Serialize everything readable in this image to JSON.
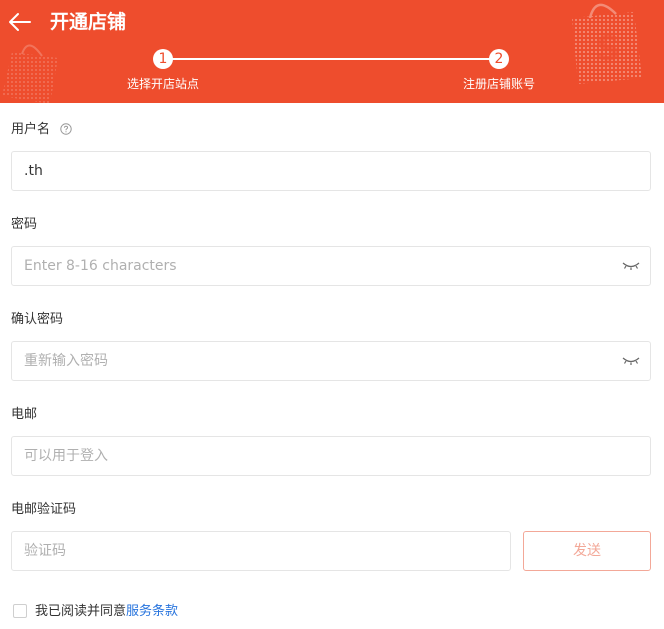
{
  "header": {
    "title": "开通店铺",
    "back_icon": "arrow-left-icon",
    "background_color": "#ee4d2d"
  },
  "steps": [
    {
      "number": "1",
      "label": "选择开店站点"
    },
    {
      "number": "2",
      "label": "注册店铺账号"
    }
  ],
  "form": {
    "username": {
      "label": "用户名",
      "value": ".th",
      "help_icon": "question-circle-icon"
    },
    "password": {
      "label": "密码",
      "placeholder": "Enter 8-16 characters",
      "icon": "eye-closed-icon"
    },
    "confirm_password": {
      "label": "确认密码",
      "placeholder": "重新输入密码",
      "icon": "eye-closed-icon"
    },
    "email": {
      "label": "电邮",
      "placeholder": "可以用于登入"
    },
    "email_code": {
      "label": "电邮验证码",
      "placeholder": "验证码",
      "send_label": "发送"
    }
  },
  "agreement": {
    "text": "我已阅读并同意",
    "link": "服务条款",
    "checked": false
  }
}
